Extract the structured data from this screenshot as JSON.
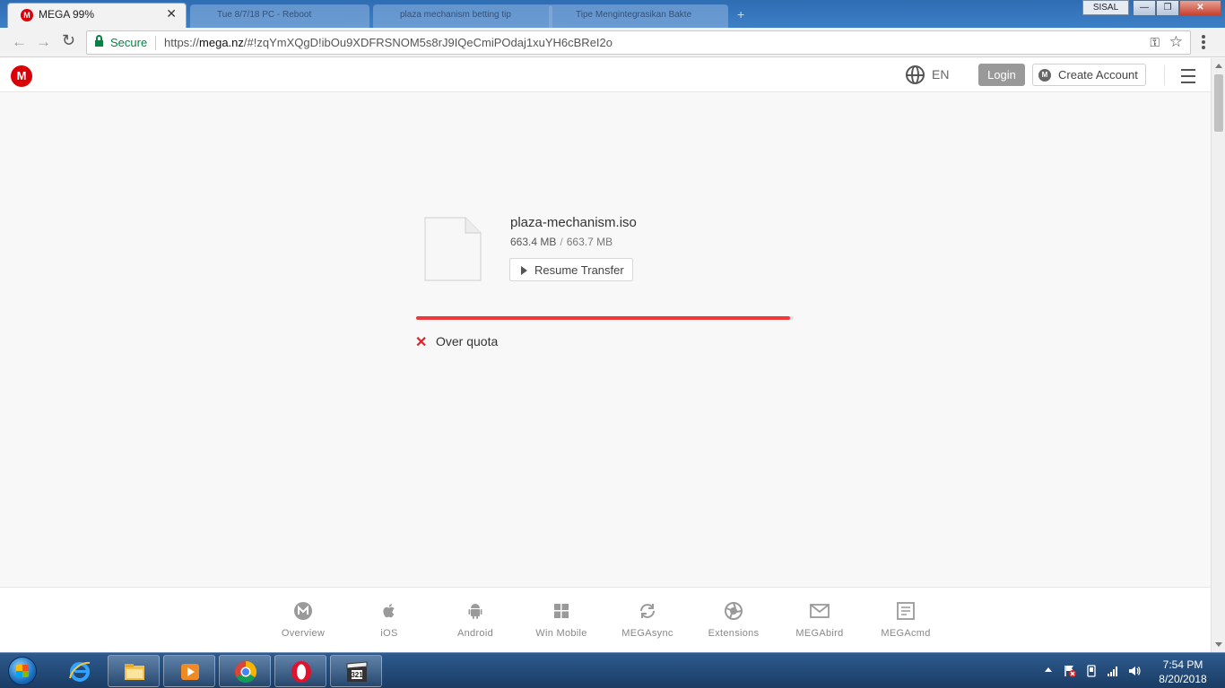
{
  "browser": {
    "active_tab": {
      "title": "MEGA 99%",
      "close": "✕"
    },
    "inactive_tabs": [
      {
        "title": "Tue 8/7/18 PC - Reboot"
      },
      {
        "title": "plaza mechanism betting tip"
      },
      {
        "title": "Tipe Mengintegrasikan Bakte"
      }
    ],
    "new_tab": "+",
    "window_user": "SISAL",
    "window_controls": {
      "minimize": "—",
      "maximize": "❐",
      "close": "✕"
    },
    "address": {
      "secure_label": "Secure",
      "url_scheme": "https://",
      "url_host": "mega.nz",
      "url_rest": "/#!zqYmXQgD!ibOu9XDFRSNOM5s8rJ9IQeCmiPOdaj1xuYH6cBReI2o"
    }
  },
  "header": {
    "logo": "M",
    "language": "EN",
    "login_label": "Login",
    "create_account_label": "Create Account",
    "create_icon": "M"
  },
  "transfer": {
    "file_name": "plaza-mechanism.iso",
    "downloaded": "663.4 MB",
    "separator": "/",
    "total": "663.7 MB",
    "resume_label": "Resume Transfer",
    "progress": 0.99,
    "status_icon": "✕",
    "status_text": "Over quota"
  },
  "footer": {
    "items": [
      {
        "label": "Overview",
        "icon": "mega-logo-icon"
      },
      {
        "label": "iOS",
        "icon": "apple-icon"
      },
      {
        "label": "Android",
        "icon": "android-icon"
      },
      {
        "label": "Win Mobile",
        "icon": "windows-icon"
      },
      {
        "label": "MEGAsync",
        "icon": "sync-icon"
      },
      {
        "label": "Extensions",
        "icon": "extensions-icon"
      },
      {
        "label": "MEGAbird",
        "icon": "mail-icon"
      },
      {
        "label": "MEGAcmd",
        "icon": "cmd-icon"
      }
    ]
  },
  "taskbar": {
    "clock_time": "7:54 PM",
    "clock_date": "8/20/2018"
  },
  "colors": {
    "mega_red": "#d90007",
    "progress_red": "#f0373a",
    "secure_green": "#0b8043"
  }
}
